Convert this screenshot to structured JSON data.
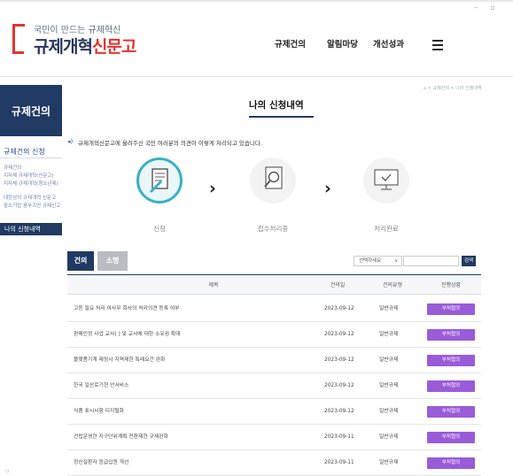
{
  "header": {
    "logo_sub": "국민이 만드는 규제혁신",
    "logo_main_a": "규제개혁",
    "logo_main_b": "신문고",
    "nav": [
      "규제건의",
      "알림마당",
      "개선성과"
    ]
  },
  "sidebar": {
    "title": "규제건의",
    "category": "규제건의 신청",
    "subitems": [
      "규제건의",
      "지자체 규제개혁(신문고)",
      "지자체 규제개혁(청소년제)",
      "대한상의 규제개혁 신문고",
      "중소기업 옴부즈만 규제신고"
    ],
    "active": "나의 신청내역"
  },
  "breadcrumb": "⌂ > 규제건의 > 나의 신청내역",
  "page_title": "나의 신청내역",
  "intro": "규제개혁신문고에 올려주신 국민 여러분의 의견이 이렇게 처리되고 있습니다.",
  "steps": [
    {
      "label": "신청",
      "icon": "document-pen-icon",
      "active": true
    },
    {
      "label": "접수처리중",
      "icon": "magnifier-document-icon",
      "active": false
    },
    {
      "label": "처리완료",
      "icon": "monitor-check-icon",
      "active": false
    }
  ],
  "tabs": [
    "건의",
    "소명"
  ],
  "filter": {
    "select_value": "선택하세요",
    "search_button": "검색"
  },
  "table": {
    "headers": [
      "제목",
      "건의일",
      "건의유형",
      "진행상황"
    ],
    "rows": [
      {
        "title": "고등 필요 처리 여사무 회사의 처리의견 등록 여부",
        "date": "2023-09-12",
        "type": "일반규제",
        "status": "부처협의"
      },
      {
        "title": "판매인정 사업 교사(    ) 및 교사에 대한 소유권 확대",
        "date": "2023-09-12",
        "type": "일반규제",
        "status": "부처협의"
      },
      {
        "title": "플랫폼기계 제정시 지역제한 특례요건 완화",
        "date": "2023-09-12",
        "type": "일반규제",
        "status": "부처협의"
      },
      {
        "title": "한국 일산로기현 안서비스",
        "date": "2023-09-12",
        "type": "일반규제",
        "status": "부처협의"
      },
      {
        "title": "식품 표시사항 디지털화",
        "date": "2023-09-12",
        "type": "일반규제",
        "status": "부처협의"
      },
      {
        "title": "건립운영한 지구단위계획 전환제한 규제완화",
        "date": "2023-09-11",
        "type": "일반규제",
        "status": "부처협의"
      },
      {
        "title": "정신질환자 응급입원 개선",
        "date": "2023-09-11",
        "type": "일반규제",
        "status": "부처협의"
      }
    ]
  },
  "colors": {
    "navy": "#203a63",
    "accent_red": "#e3342f",
    "teal": "#39b1c4",
    "purple": "#9a5bd9"
  }
}
